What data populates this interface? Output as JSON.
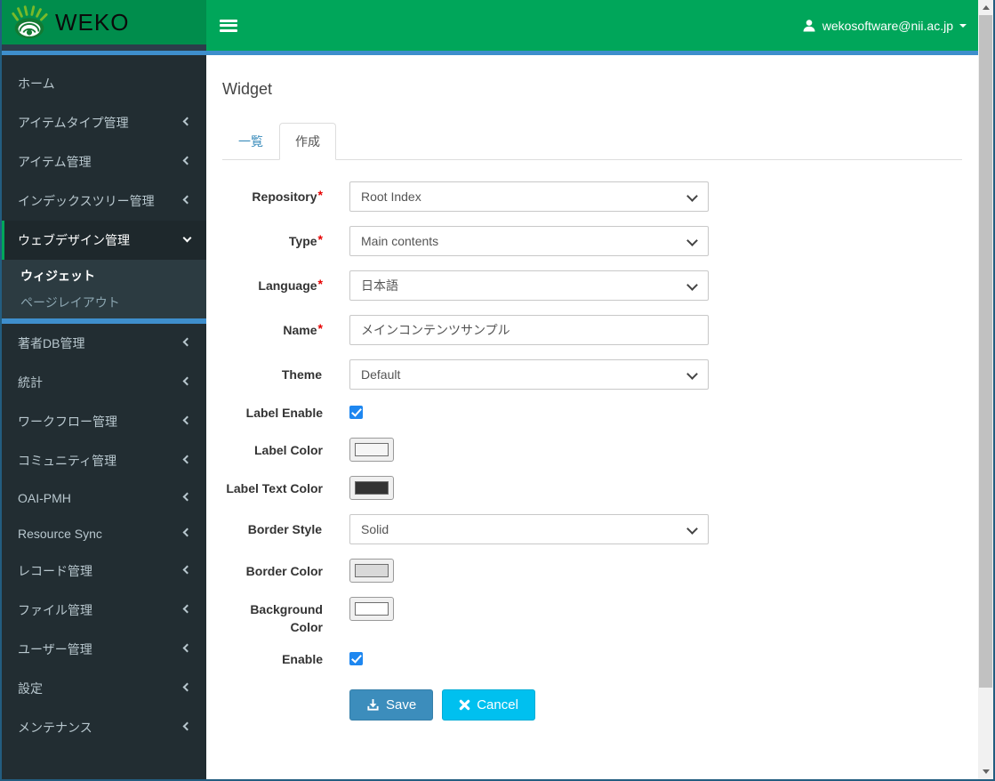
{
  "header": {
    "logo_text": "WEKO",
    "user": {
      "email": "wekosoftware@nii.ac.jp"
    }
  },
  "icons": {
    "logo": "weko-hedgehog-logo",
    "menu_toggle": "hamburger-icon",
    "user": "person-icon",
    "user_caret": "caret-down-icon",
    "collapsed_menu": "chevron-left-icon",
    "expanded_menu": "chevron-down-icon",
    "select_arrow": "chevron-down-icon",
    "save": "download-icon",
    "cancel": "x-icon",
    "scroll_up": "triangle-up-icon",
    "scroll_down": "triangle-down-icon"
  },
  "sidebar": {
    "items": [
      {
        "label": "ホーム",
        "chevron": "none",
        "active": false
      },
      {
        "label": "アイテムタイプ管理",
        "chevron": "left",
        "active": false
      },
      {
        "label": "アイテム管理",
        "chevron": "left",
        "active": false
      },
      {
        "label": "インデックスツリー管理",
        "chevron": "left",
        "active": false
      },
      {
        "label": "ウェブデザイン管理",
        "chevron": "down",
        "active": true,
        "expanded": true
      },
      {
        "label": "著者DB管理",
        "chevron": "left",
        "active": false
      },
      {
        "label": "統計",
        "chevron": "left",
        "active": false
      },
      {
        "label": "ワークフロー管理",
        "chevron": "left",
        "active": false
      },
      {
        "label": "コミュニティ管理",
        "chevron": "left",
        "active": false
      },
      {
        "label": "OAI-PMH",
        "chevron": "left",
        "active": false
      },
      {
        "label": "Resource Sync",
        "chevron": "left",
        "active": false
      },
      {
        "label": "レコード管理",
        "chevron": "left",
        "active": false
      },
      {
        "label": "ファイル管理",
        "chevron": "left",
        "active": false
      },
      {
        "label": "ユーザー管理",
        "chevron": "left",
        "active": false
      },
      {
        "label": "設定",
        "chevron": "left",
        "active": false
      },
      {
        "label": "メンテナンス",
        "chevron": "left",
        "active": false
      }
    ],
    "submenu": [
      {
        "label": "ウィジェット",
        "active": true
      },
      {
        "label": "ページレイアウト",
        "active": false
      }
    ]
  },
  "main": {
    "title": "Widget",
    "tabs": [
      {
        "label": "一覧",
        "active": false
      },
      {
        "label": "作成",
        "active": true
      }
    ],
    "form": {
      "repository": {
        "label": "Repository",
        "mark": "*",
        "value": "Root Index"
      },
      "type": {
        "label": "Type",
        "mark": "*",
        "value": "Main contents"
      },
      "language": {
        "label": "Language",
        "mark": "*",
        "value": "日本語"
      },
      "name": {
        "label": "Name",
        "mark": "*",
        "value": "メインコンテンツサンプル"
      },
      "theme": {
        "label": "Theme",
        "mark": "",
        "value": "Default"
      },
      "label_enable": {
        "label": "Label Enable",
        "checked": true
      },
      "label_color": {
        "label": "Label Color",
        "value": "#f5f5f5"
      },
      "label_text_color": {
        "label": "Label Text Color",
        "value": "#333333"
      },
      "border_style": {
        "label": "Border Style",
        "mark": "",
        "value": "Solid"
      },
      "border_color": {
        "label": "Border Color",
        "value": "#d9d9d9"
      },
      "background_color": {
        "label": "Background Color",
        "value": "#ffffff"
      },
      "enable": {
        "label": "Enable",
        "checked": true
      }
    },
    "actions": {
      "save": "Save",
      "cancel": "Cancel"
    }
  },
  "colors": {
    "navbar_green": "#00a65a",
    "logo_green": "#008d4c",
    "accent_blue": "#3e8ecc",
    "sidebar_bg": "#222d32",
    "sidebar_submenu_bg": "#2c3b41",
    "sidebar_text": "#b8c7ce",
    "active_border_green": "#00a65a",
    "save_button": "#3c8dbc",
    "cancel_button": "#00c0ef",
    "checkbox_blue": "#1e87f0",
    "link_blue": "#3c8dbc",
    "required_red": "#e60000",
    "window_border": "#235d80"
  }
}
